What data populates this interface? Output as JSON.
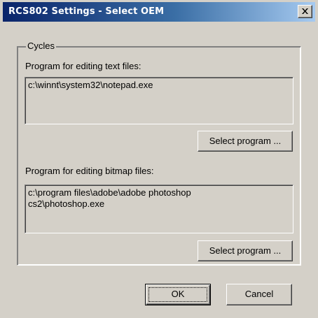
{
  "window": {
    "title": "RCS802 Settings - Select OEM",
    "close_label": "Close"
  },
  "group": {
    "label": "Cycles"
  },
  "text_editor": {
    "label": "Program for editing text files:",
    "value": "c:\\winnt\\system32\\notepad.exe",
    "button_label": "Select program ..."
  },
  "bitmap_editor": {
    "label": "Program for editing bitmap files:",
    "value": "c:\\program files\\adobe\\adobe photoshop\ncs2\\photoshop.exe",
    "button_label": "Select program ..."
  },
  "footer": {
    "ok_label": "OK",
    "cancel_label": "Cancel"
  },
  "colors": {
    "titlebar_start": "#0a246a",
    "titlebar_end": "#a6caf0",
    "dialog_face": "#d4d0c8"
  },
  "icons": {
    "close": "close-icon"
  }
}
